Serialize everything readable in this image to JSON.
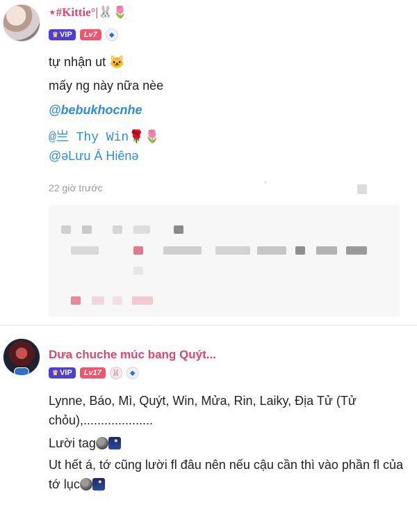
{
  "post1": {
    "username": "⋆#Kittie°|🐰🌷",
    "vip_label": "VIP",
    "level_label": "Lv7",
    "lines": [
      "tự nhận ut 🐱",
      "mấy ng này nữa nèe"
    ],
    "mentions": [
      "@bebukhocnhe",
      "@亗   Thy Win🌹🌷",
      "@ǝLưu Á Hiênǝ"
    ],
    "timestamp": "22 giờ trước"
  },
  "post2": {
    "username": "Dưa chuche múc bang Quýt...",
    "vip_label": "VIP",
    "level_label": "Lv17",
    "text_1": "Lynne, Báo, Mì, Quýt, Win, Mửa, Rin, Laiky, Địa Tử (Tử chỏu),....................",
    "text_2": "Lười tag",
    "text_3": "Ut hết á, tớ cũng lười fl đâu nên nếu cậu cần thì vào phần fl của tớ lục"
  },
  "icons": {
    "crown": "crown-icon",
    "ethereum": "ethereum-badge-icon",
    "rabbit": "rabbit-badge-icon"
  },
  "colors": {
    "username_pink": "#e0456a",
    "mention_blue": "#2c8ee0",
    "vip_purple": "#4b3fd8",
    "level_red": "#f2546e"
  }
}
